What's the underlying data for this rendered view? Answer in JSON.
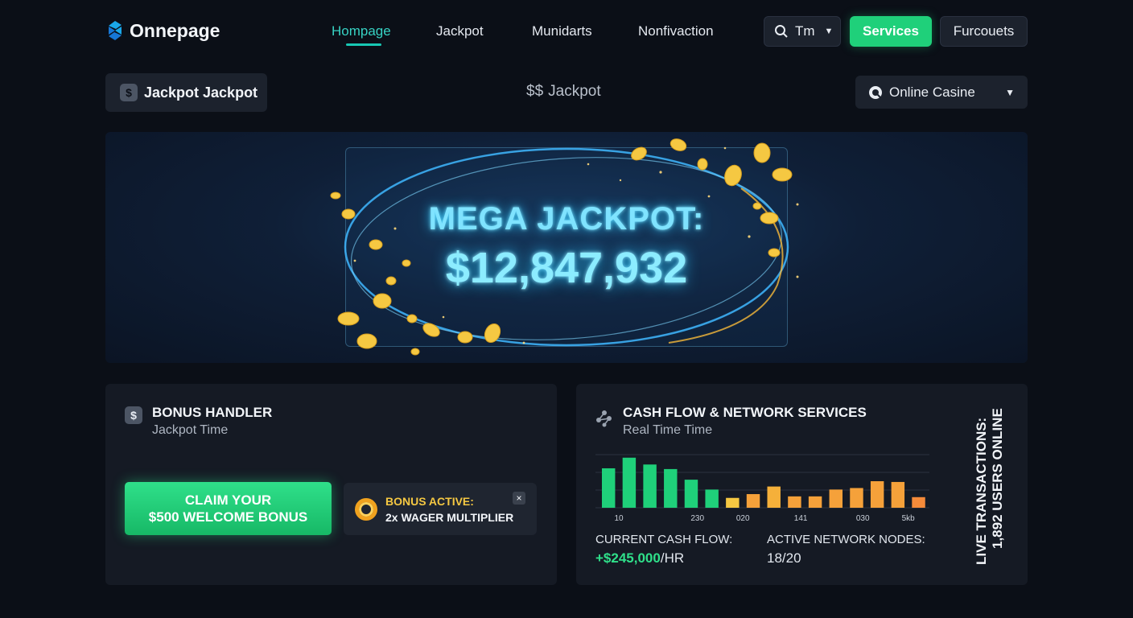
{
  "brand": {
    "name": "Onnepage"
  },
  "nav": {
    "items": [
      "Hompage",
      "Jackpot",
      "Munidarts",
      "Nonfivaction"
    ],
    "active": 0
  },
  "header": {
    "search_label": "Tm",
    "services_label": "Services",
    "right_label": "Furcouets"
  },
  "subbar": {
    "left_label": "Jackpot Jackpot",
    "center_prefix": "$$",
    "center_label": "Jackpot",
    "right_label": "Online Casine"
  },
  "hero": {
    "title": "MEGA JACKPOT:",
    "amount": "$12,847,932"
  },
  "bonus": {
    "title": "BONUS HANDLER",
    "subtitle": "Jackpot Time",
    "claim_line1": "CLAIM YOUR",
    "claim_line2": "$500 WELCOME BONUS",
    "active_line1": "BONUS ACTIVE:",
    "active_line2": "2x WAGER MULTIPLIER",
    "close": "×"
  },
  "network": {
    "title": "CASH FLOW & NETWORK SERVICES",
    "subtitle": "Real Time Time",
    "cash_label": "CURRENT CASH FLOW:",
    "cash_value": "+$245,000",
    "cash_unit": "/HR",
    "nodes_label": "ACTIVE NETWORK NODES:",
    "nodes_value": "18/20",
    "vertical_line1": "LIVE TRANSACTIONS:",
    "vertical_line2": "1,892 USERS ONLINE"
  },
  "chart_data": {
    "type": "bar",
    "tick_labels": [
      "10",
      "230",
      "020",
      "141",
      "030",
      "5kb"
    ],
    "values": [
      52,
      66,
      57,
      51,
      37,
      24,
      13,
      18,
      28,
      15,
      15,
      24,
      26,
      35,
      34,
      14
    ],
    "colors": [
      "#1fd07a",
      "#1fd07a",
      "#1fd07a",
      "#1fd07a",
      "#1fd07a",
      "#1fd07a",
      "#f5c842",
      "#f5a13a",
      "#f5b03a",
      "#f5a13a",
      "#f5a13a",
      "#f5a13a",
      "#f5a13a",
      "#f5a13a",
      "#f5a13a",
      "#f58b3a"
    ],
    "ylim": [
      0,
      70
    ],
    "grid": true
  },
  "colors": {
    "accent_green": "#1fd07a",
    "accent_cyan": "#37d2c3",
    "gold": "#f5c842"
  }
}
